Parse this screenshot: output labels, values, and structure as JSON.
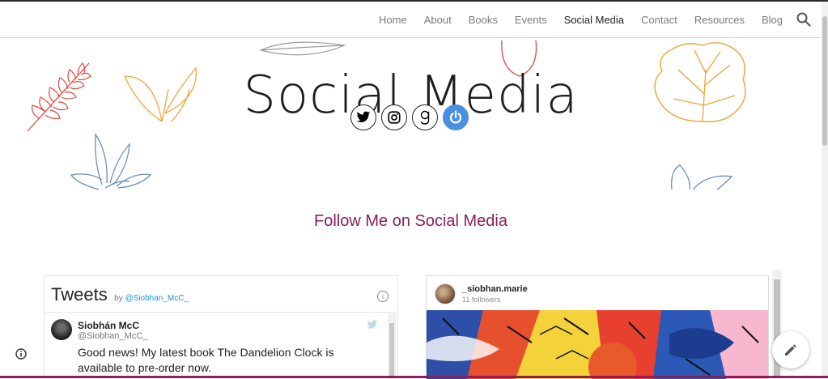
{
  "nav": {
    "items": [
      {
        "label": "Home",
        "active": false
      },
      {
        "label": "About",
        "active": false
      },
      {
        "label": "Books",
        "active": false
      },
      {
        "label": "Events",
        "active": false
      },
      {
        "label": "Social Media",
        "active": true
      },
      {
        "label": "Contact",
        "active": false
      },
      {
        "label": "Resources",
        "active": false
      },
      {
        "label": "Blog",
        "active": false
      }
    ],
    "search_icon": "search-icon"
  },
  "hero": {
    "title": "Social Media"
  },
  "social_icons": [
    "twitter-icon",
    "instagram-icon",
    "goodreads-icon",
    "blog-power-icon"
  ],
  "section": {
    "heading": "Follow Me on Social Media"
  },
  "twitter": {
    "title": "Tweets",
    "by": "by",
    "handle": "@Siobhan_McC_",
    "tweet": {
      "name": "Siobhán McC",
      "handle": "@Siobhan_McC_",
      "text": "Good news! My latest book The Dandelion Clock is available to pre-order now."
    }
  },
  "instagram": {
    "username": "_siobhan.marie",
    "followers": "11 followers"
  },
  "colors": {
    "accent": "#8a1f5a",
    "twitter_blue": "#1b95e0",
    "leaf_red": "#e0473f",
    "leaf_orange": "#eda33a",
    "leaf_blue": "#6a8fb8"
  }
}
